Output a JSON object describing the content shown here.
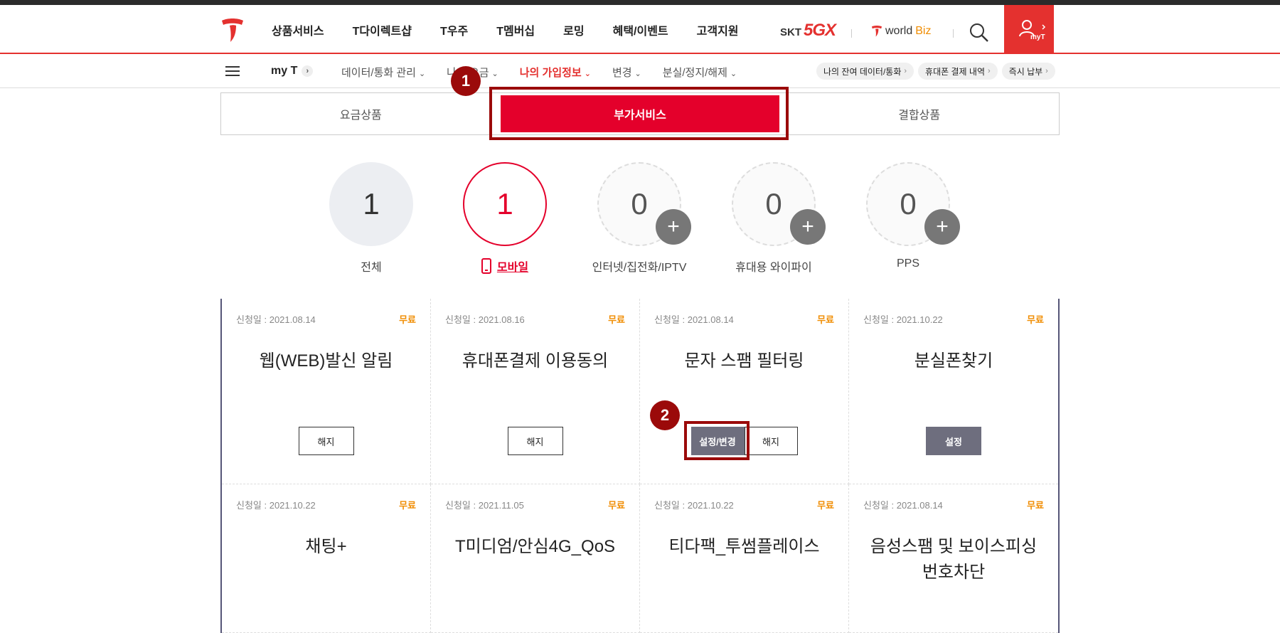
{
  "gnb": {
    "menu": [
      "상품서비스",
      "T다이렉트샵",
      "T우주",
      "T멤버십",
      "로밍",
      "혜택/이벤트",
      "고객지원"
    ],
    "skt_label": "SKT",
    "fiveg_label": "5GX",
    "worldbiz_a": "world",
    "worldbiz_b": "Biz",
    "myt_label": "myT"
  },
  "lnb": {
    "myt": "my T",
    "items": [
      {
        "label": "데이터/통화 관리"
      },
      {
        "label": "나의 요금"
      },
      {
        "label": "나의 가입정보"
      },
      {
        "label": "변경"
      },
      {
        "label": "분실/정지/해제"
      }
    ],
    "quick": [
      "나의 잔여 데이터/통화",
      "휴대폰 결제 내역",
      "즉시 납부"
    ]
  },
  "tabs": [
    "요금상품",
    "부가서비스",
    "결합상품"
  ],
  "steps": {
    "one": "1",
    "two": "2"
  },
  "summary": [
    {
      "count": "1",
      "label": "전체"
    },
    {
      "count": "1",
      "label": "모바일"
    },
    {
      "count": "0",
      "label": "인터넷/집전화/IPTV",
      "plus": "+"
    },
    {
      "count": "0",
      "label": "휴대용 와이파이",
      "plus": "+"
    },
    {
      "count": "0",
      "label": "PPS",
      "plus": "+"
    }
  ],
  "cards": [
    {
      "date": "신청일 : 2021.08.14",
      "fee": "무료",
      "name": "웹(WEB)발신 알림",
      "btn1": "해지"
    },
    {
      "date": "신청일 : 2021.08.16",
      "fee": "무료",
      "name": "휴대폰결제 이용동의",
      "btn1": "해지"
    },
    {
      "date": "신청일 : 2021.08.14",
      "fee": "무료",
      "name": "문자 스팸 필터링",
      "btn1": "설정/변경",
      "btn2": "해지"
    },
    {
      "date": "신청일 : 2021.10.22",
      "fee": "무료",
      "name": "분실폰찾기",
      "btn1": "설정"
    },
    {
      "date": "신청일 : 2021.10.22",
      "fee": "무료",
      "name": "채팅+"
    },
    {
      "date": "신청일 : 2021.11.05",
      "fee": "무료",
      "name": "T미디엄/안심4G_QoS"
    },
    {
      "date": "신청일 : 2021.10.22",
      "fee": "무료",
      "name": "티다팩_투썸플레이스"
    },
    {
      "date": "신청일 : 2021.08.14",
      "fee": "무료",
      "name": "음성스팸 및 보이스피싱번호차단"
    }
  ]
}
